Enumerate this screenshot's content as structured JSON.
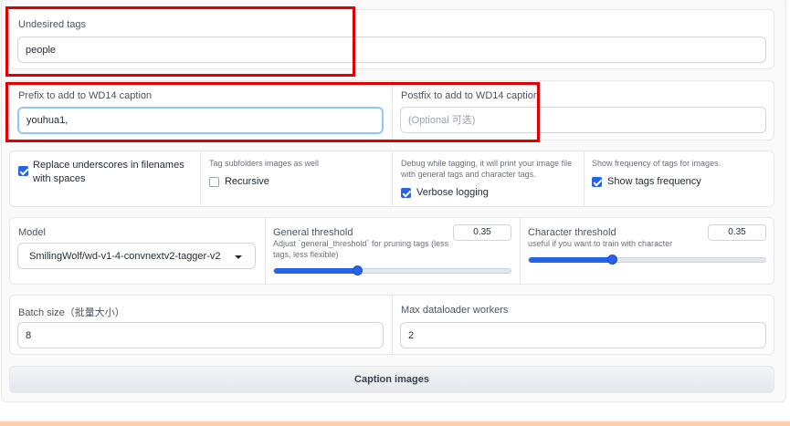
{
  "undesired_tags": {
    "label": "Undesired tags",
    "value": "people"
  },
  "prefix": {
    "label": "Prefix to add to WD14 caption",
    "value": "youhua1,"
  },
  "postfix": {
    "label": "Postfix to add to WD14 caption",
    "placeholder": "(Optional 可选)"
  },
  "options": {
    "replace_underscores": {
      "label": "Replace underscores in filenames with spaces",
      "checked": true
    },
    "recursive": {
      "info": "Tag subfolders images as well",
      "label": "Recursive",
      "checked": false
    },
    "verbose": {
      "info": "Debug while tagging, it will print your image file with general tags and character tags.",
      "label": "Verbose logging",
      "checked": true
    },
    "frequency": {
      "info": "Show frequency of tags for images.",
      "label": "Show tags frequency",
      "checked": true
    }
  },
  "model": {
    "label": "Model",
    "value": "SmilingWolf/wd-v1-4-convnextv2-tagger-v2"
  },
  "general_threshold": {
    "label": "General threshold",
    "info": "Adjust `general_threshold` for pruning tags (less tags, less flexible)",
    "value": "0.35",
    "fraction": 0.35
  },
  "character_threshold": {
    "label": "Character threshold",
    "info": "useful if you want to train with character",
    "value": "0.35",
    "fraction": 0.35
  },
  "batch_size": {
    "label": "Batch size（批量大小）",
    "value": "8"
  },
  "max_workers": {
    "label": "Max dataloader workers",
    "value": "2"
  },
  "caption_button": {
    "label": "Caption images"
  },
  "colors": {
    "accent": "#2563eb",
    "highlight": "#e00000"
  }
}
